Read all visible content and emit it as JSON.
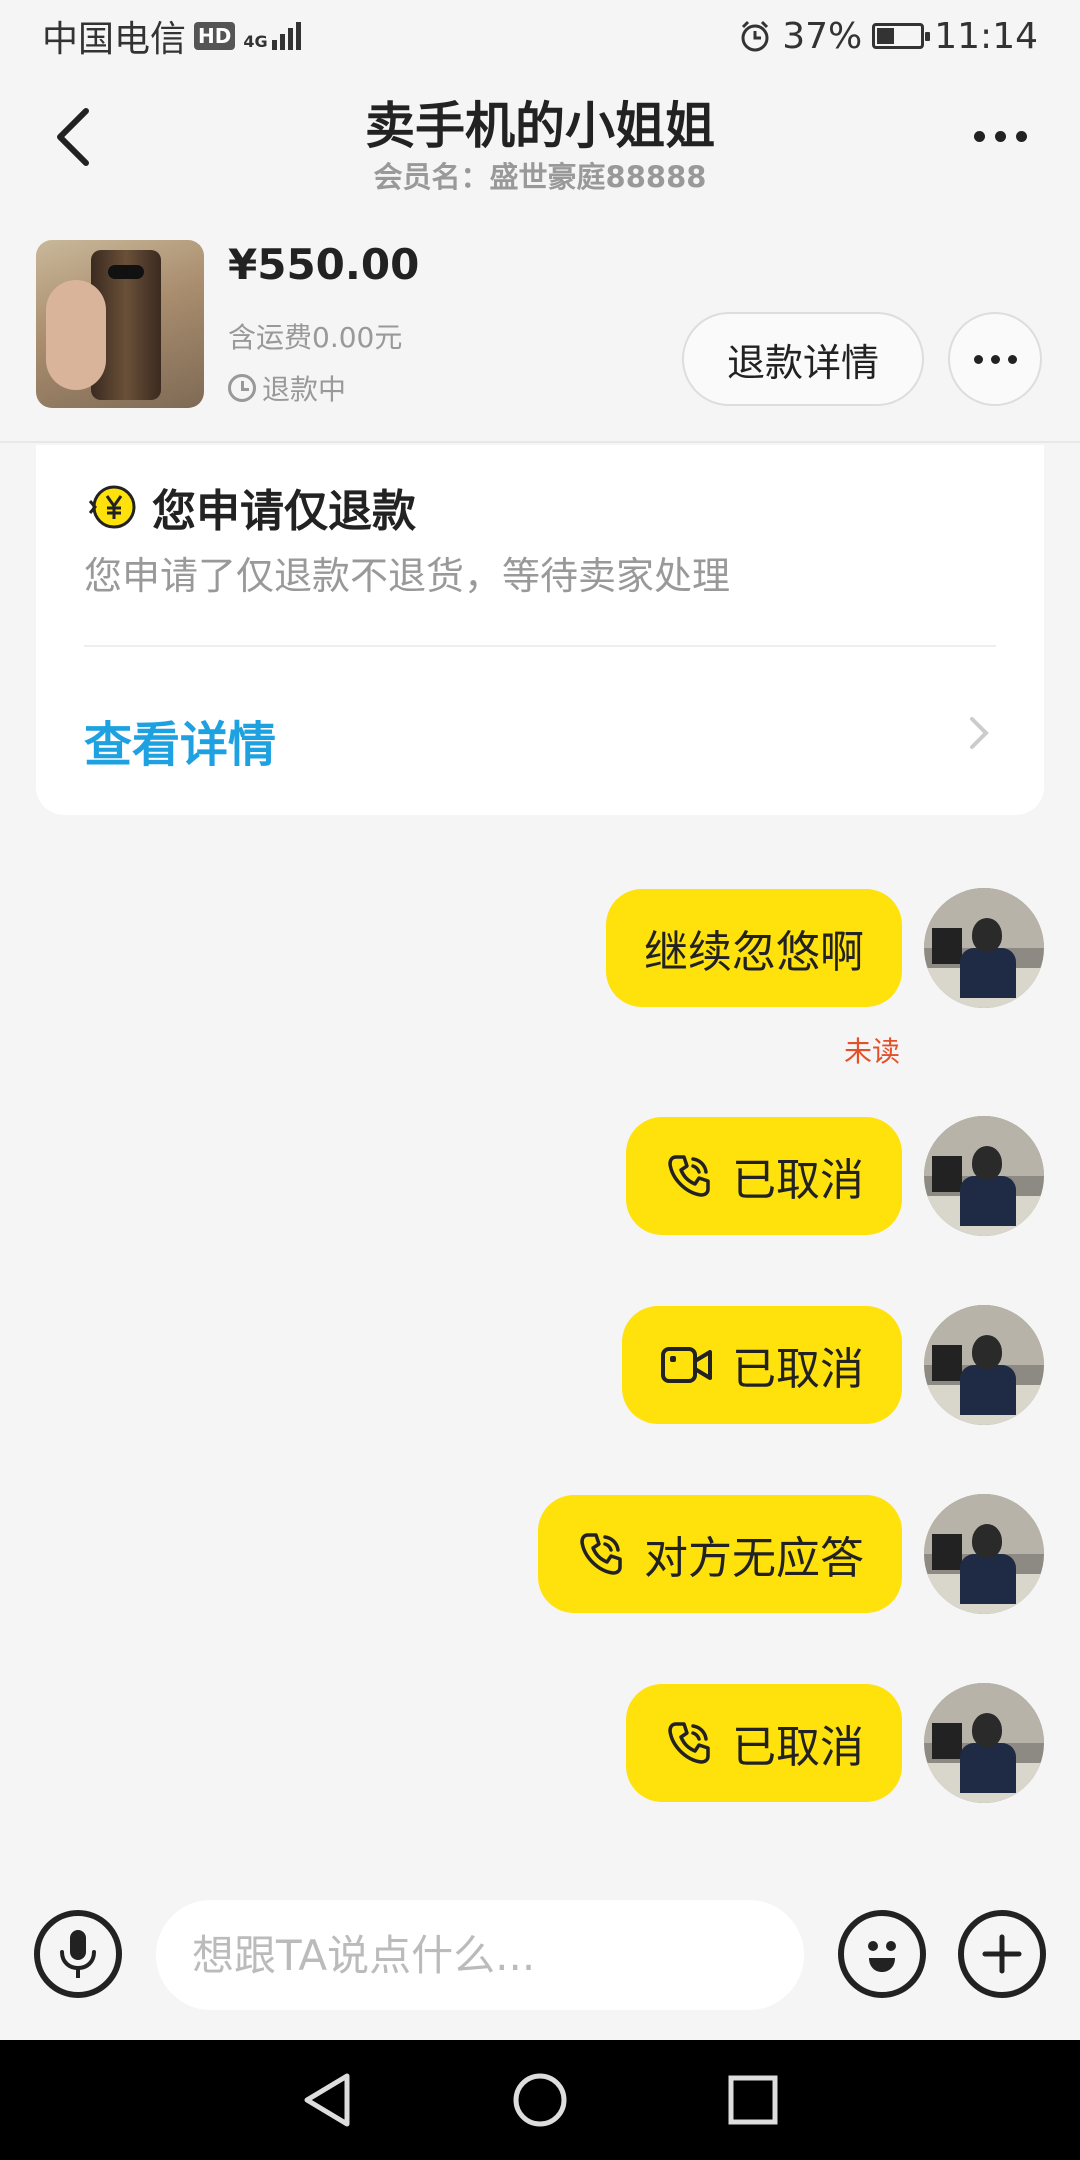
{
  "status_bar": {
    "carrier": "中国电信",
    "hd": "HD",
    "network": "4G",
    "battery": "37%",
    "time": "11:14"
  },
  "header": {
    "title": "卖手机的小姐姐",
    "subtitle": "会员名：盛世豪庭88888"
  },
  "product": {
    "price": "¥550.00",
    "shipping": "含运费0.00元",
    "status": "退款中",
    "refund_detail_label": "退款详情"
  },
  "refund_card": {
    "title": "您申请仅退款",
    "description": "您申请了仅退款不退货，等待卖家处理",
    "link": "查看详情"
  },
  "messages": [
    {
      "type": "text",
      "text": "继续忽悠啊",
      "icon": null
    },
    {
      "type": "call",
      "text": "已取消",
      "icon": "phone-icon"
    },
    {
      "type": "video",
      "text": "已取消",
      "icon": "video-icon"
    },
    {
      "type": "call",
      "text": "对方无应答",
      "icon": "phone-icon"
    },
    {
      "type": "call",
      "text": "已取消",
      "icon": "phone-icon"
    }
  ],
  "unread_label": "未读",
  "input": {
    "placeholder": "想跟TA说点什么..."
  },
  "colors": {
    "bubble": "#ffe10c",
    "link": "#1da1e0",
    "unread": "#e2512a"
  }
}
